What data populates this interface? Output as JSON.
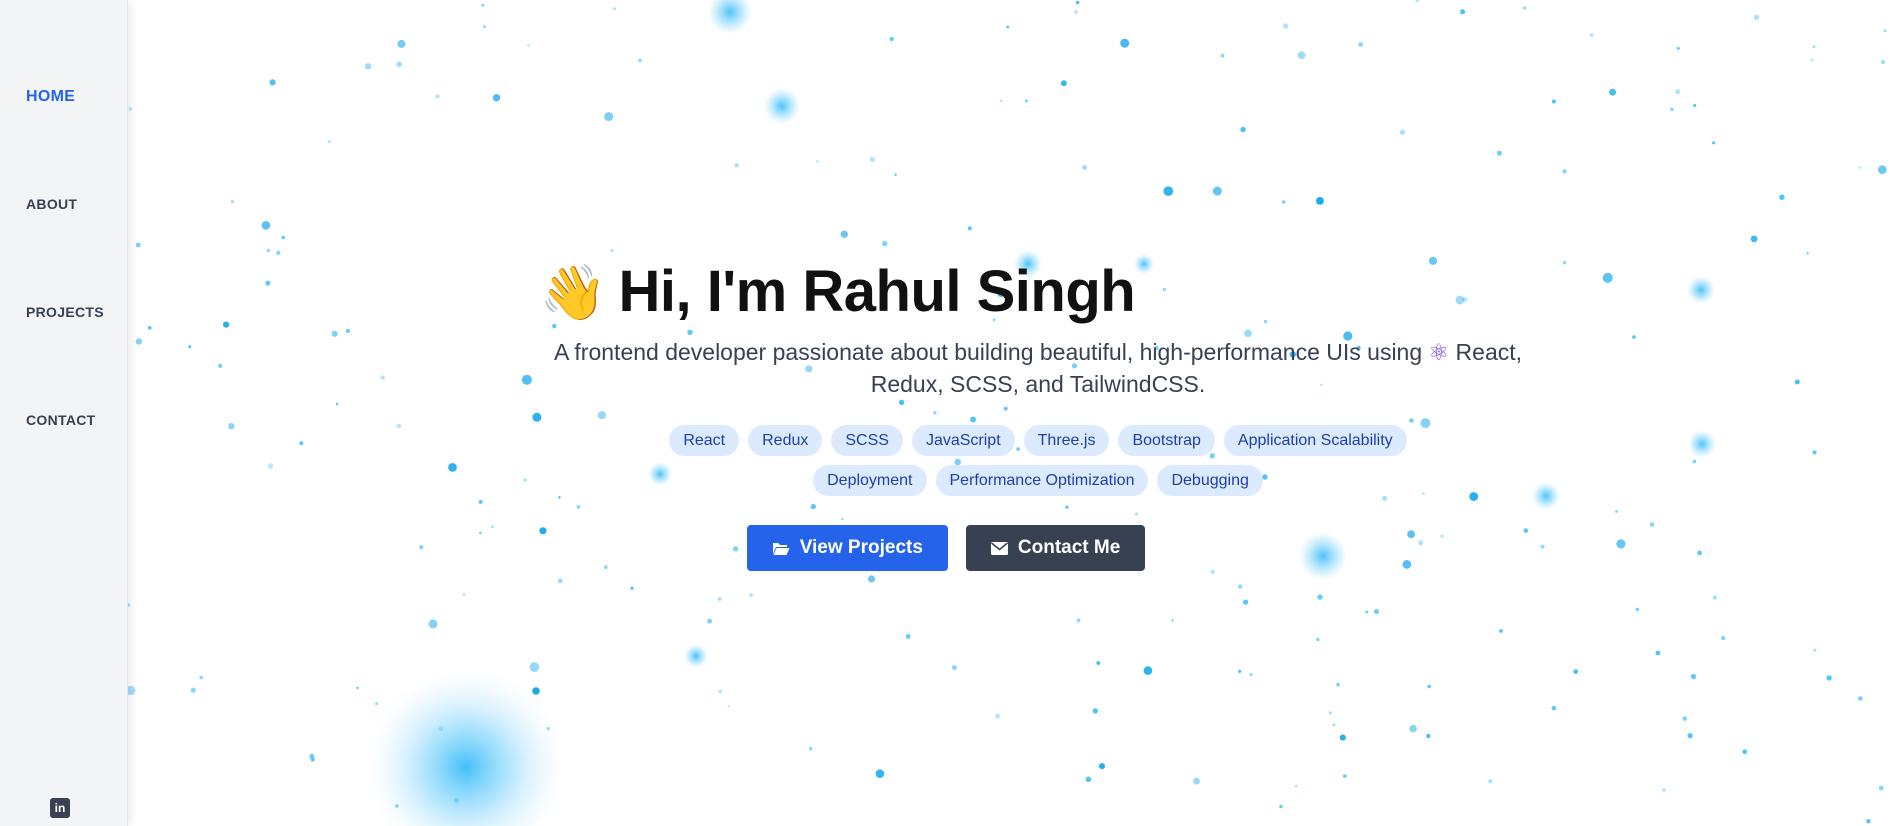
{
  "sidebar": {
    "items": [
      {
        "label": "HOME",
        "active": true
      },
      {
        "label": "ABOUT",
        "active": false
      },
      {
        "label": "PROJECTS",
        "active": false
      },
      {
        "label": "CONTACT",
        "active": false
      }
    ],
    "social": {
      "linkedin_label": "in",
      "icon": "linkedin-icon"
    }
  },
  "hero": {
    "wave_emoji": "👋",
    "title": "Hi, I'm Rahul Singh",
    "subtitle_before": "A frontend developer passionate about building beautiful, high-performance UIs using",
    "atom_emoji": "⚛",
    "subtitle_after": "React, Redux, SCSS, and TailwindCSS.",
    "skills": [
      "React",
      "Redux",
      "SCSS",
      "JavaScript",
      "Three.js",
      "Bootstrap",
      "Application Scalability",
      "Deployment",
      "Performance Optimization",
      "Debugging"
    ],
    "buttons": {
      "view_projects": "View Projects",
      "contact_me": "Contact Me"
    }
  },
  "colors": {
    "accent": "#2563eb",
    "dark": "#374151",
    "tag_bg": "#dbeafe",
    "tag_text": "#1e40af",
    "particle": "#38bdf8"
  }
}
